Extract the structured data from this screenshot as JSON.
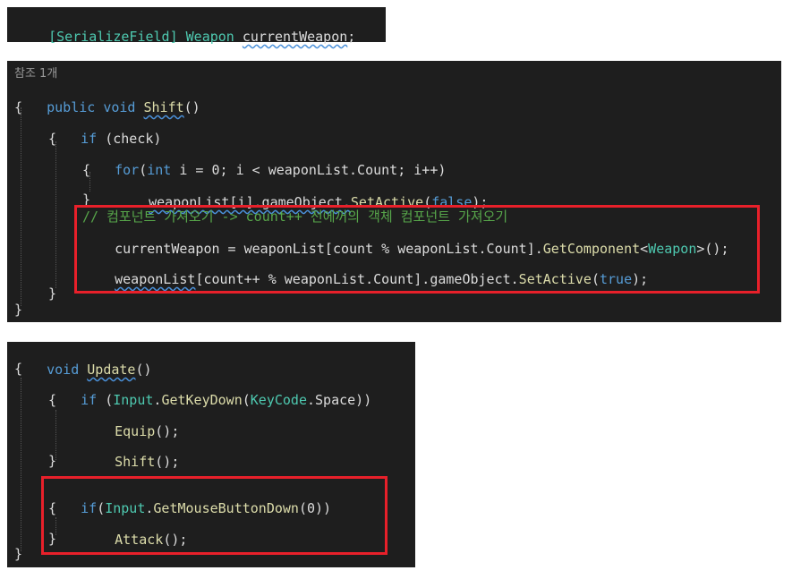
{
  "panel_field": {
    "attr": "[SerializeField]",
    "type": "Weapon",
    "name": "currentWeapon",
    "semi": ";"
  },
  "panel_shift": {
    "ref_count": "참조 1개",
    "sig": {
      "kw1": "public",
      "kw2": "void",
      "name": "Shift",
      "parens": "()"
    },
    "brace_open": "{",
    "if_kw": "if",
    "if_cond": " (check)",
    "brace2_open": "{",
    "for_kw": "for",
    "for_paren": "(",
    "for_int": "int",
    "for_rest": " i = 0; i < weaponList.Count; i++)",
    "brace3_open": "{",
    "set_line_a": "weaponList[i].gameObject.",
    "set_method": "SetActive",
    "set_paren": "(",
    "set_false": "false",
    "set_end": ");",
    "brace3_close": "}",
    "comment": "// 컴포넌트 가져오기 -> count++ 전에꺼의 객체 컴포넌트 가져오기",
    "cw_a": "currentWeapon = weaponList[count % weaponList.Count].",
    "cw_method": "GetComponent",
    "cw_lt": "<",
    "cw_type": "Weapon",
    "cw_end": ">();",
    "wl_a": "weaponList",
    "wl_b": "[count++ % weaponList.Count].gameObject.",
    "wl_method": "SetActive",
    "wl_paren": "(",
    "wl_true": "true",
    "wl_end": ");",
    "brace2_close": "}",
    "brace_close": "}"
  },
  "panel_update": {
    "sig": {
      "kw": "void",
      "name": "Update",
      "parens": "()"
    },
    "brace_open": "{",
    "if_kw": "if",
    "if_a": " (",
    "if_type": "Input",
    "if_dot": ".",
    "if_method": "GetKeyDown",
    "if_paren": "(",
    "if_key": "KeyCode",
    "if_rest": ".Space))",
    "brace2_open": "{",
    "equip": "Equip",
    "equip_end": "();",
    "shift": "Shift",
    "shift_end": "();",
    "brace2_close": "}",
    "if2_kw": "if",
    "if2_paren": "(",
    "if2_type": "Input",
    "if2_dot": ".",
    "if2_method": "GetMouseButtonDown",
    "if2_rest": "(0))",
    "brace3_open": "{",
    "attack": "Attack",
    "attack_end": "();",
    "brace3_close": "}",
    "brace_close": "}"
  },
  "colors": {
    "background": "#1e1e1e",
    "keyword": "#569cd6",
    "type": "#4ec9b0",
    "method": "#dcdcaa",
    "comment": "#57a64a",
    "highlight_box": "#e8202a"
  }
}
